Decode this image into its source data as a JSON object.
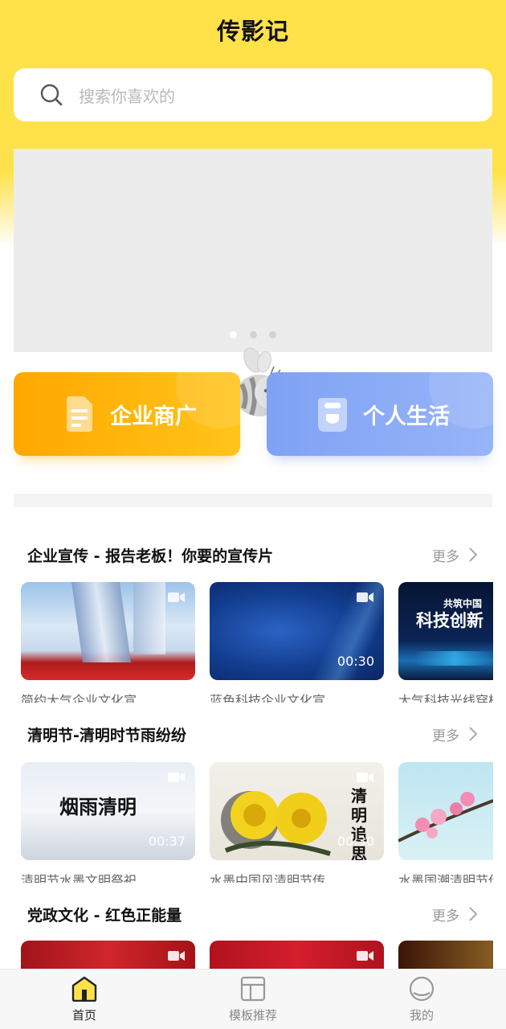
{
  "header": {
    "title": "传影记"
  },
  "search": {
    "placeholder": "搜索你喜欢的"
  },
  "banner": {
    "dots": 3,
    "active_dot": 0
  },
  "categories": [
    {
      "label": "企业商广",
      "color": "#FFB300",
      "icon": "document-icon"
    },
    {
      "label": "个人生活",
      "color": "#8AABF6",
      "icon": "cup-icon"
    }
  ],
  "sections": [
    {
      "title": "企业宣传 - 报告老板！你要的宣传片",
      "more": "更多",
      "items": [
        {
          "caption": "简约大气企业文化宣",
          "duration": ""
        },
        {
          "caption": "蓝色科技企业文化宣",
          "duration": "00:30"
        },
        {
          "caption": "大气科技光线穿梭",
          "duration": "",
          "overlay": "科技创新",
          "overlay_top": "共筑中国"
        }
      ]
    },
    {
      "title": "清明节-清明时节雨纷纷",
      "more": "更多",
      "items": [
        {
          "caption": "清明节水墨文明祭祀",
          "duration": "00:37",
          "overlay": "烟雨清明"
        },
        {
          "caption": "水墨中国风清明节传",
          "duration": "00:30",
          "overlay": "清明追思"
        },
        {
          "caption": "水墨国潮清明节传",
          "duration": ""
        }
      ]
    },
    {
      "title": "党政文化 - 红色正能量",
      "more": "更多",
      "items": [
        {
          "caption": ""
        },
        {
          "caption": ""
        },
        {
          "caption": ""
        }
      ]
    }
  ],
  "tabbar": [
    {
      "label": "首页",
      "icon": "home-icon",
      "active": true
    },
    {
      "label": "模板推荐",
      "icon": "template-icon",
      "active": false
    },
    {
      "label": "我的",
      "icon": "profile-icon",
      "active": false
    }
  ],
  "colors": {
    "brand_yellow": "#FFE24A",
    "orange": "#FFB300",
    "blue": "#8AABF6"
  }
}
